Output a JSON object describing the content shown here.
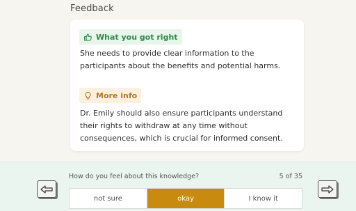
{
  "feedback": {
    "heading": "Feedback",
    "correct": {
      "label": "What you got right",
      "icon": "thumbs-up-icon",
      "text": "She needs to provide clear information to the participants about the benefits and potential harms."
    },
    "more": {
      "label": "More info",
      "icon": "lightbulb-icon",
      "text": "Dr. Emily should also ensure participants understand their rights to withdraw at any time without consequences, which is crucial for informed consent."
    }
  },
  "rating": {
    "question": "How do you feel about this knowledge?",
    "counter": "5 of 35",
    "options": [
      "not sure",
      "okay",
      "I know it"
    ],
    "selected": "okay",
    "selected_color": "#c98a10"
  },
  "nav": {
    "prev_icon": "arrow-left-icon",
    "next_icon": "arrow-right-icon"
  },
  "colors": {
    "correct_chip_bg": "#e7f5ea",
    "correct_chip_text": "#2f8a4a",
    "more_chip_bg": "#fcf1e0",
    "more_chip_text": "#b37a25",
    "bottom_bar_bg": "#eaf5f0"
  }
}
